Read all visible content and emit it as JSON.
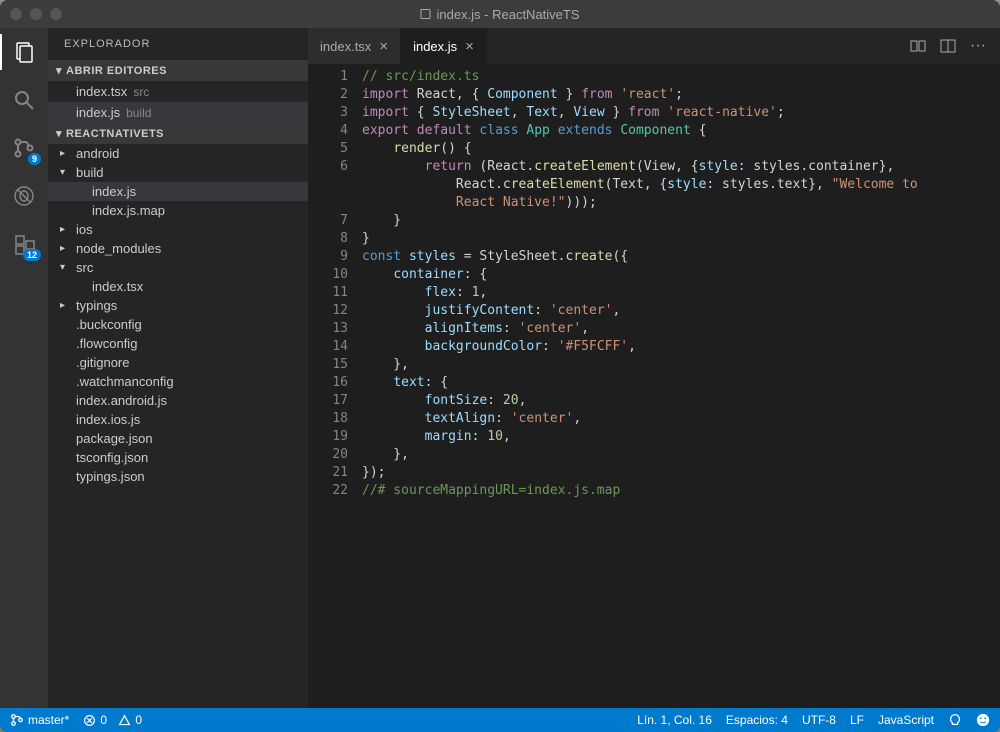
{
  "window": {
    "title": "index.js - ReactNativeTS"
  },
  "activitybar": {
    "badges": {
      "scm": "9",
      "extensions": "12"
    }
  },
  "sidebar": {
    "title": "EXPLORADOR",
    "openEditorsHeader": "ABRIR EDITORES",
    "openEditors": [
      {
        "name": "index.tsx",
        "hint": "src"
      },
      {
        "name": "index.js",
        "hint": "build"
      }
    ],
    "projectHeader": "REACTNATIVETS",
    "tree": [
      {
        "label": "android",
        "depth": 0,
        "arrow": "▸"
      },
      {
        "label": "build",
        "depth": 0,
        "arrow": "▾"
      },
      {
        "label": "index.js",
        "depth": 1,
        "arrow": "",
        "selected": true
      },
      {
        "label": "index.js.map",
        "depth": 1,
        "arrow": ""
      },
      {
        "label": "ios",
        "depth": 0,
        "arrow": "▸"
      },
      {
        "label": "node_modules",
        "depth": 0,
        "arrow": "▸"
      },
      {
        "label": "src",
        "depth": 0,
        "arrow": "▾"
      },
      {
        "label": "index.tsx",
        "depth": 1,
        "arrow": ""
      },
      {
        "label": "typings",
        "depth": 0,
        "arrow": "▸"
      },
      {
        "label": ".buckconfig",
        "depth": 0,
        "arrow": ""
      },
      {
        "label": ".flowconfig",
        "depth": 0,
        "arrow": ""
      },
      {
        "label": ".gitignore",
        "depth": 0,
        "arrow": ""
      },
      {
        "label": ".watchmanconfig",
        "depth": 0,
        "arrow": ""
      },
      {
        "label": "index.android.js",
        "depth": 0,
        "arrow": ""
      },
      {
        "label": "index.ios.js",
        "depth": 0,
        "arrow": ""
      },
      {
        "label": "package.json",
        "depth": 0,
        "arrow": ""
      },
      {
        "label": "tsconfig.json",
        "depth": 0,
        "arrow": ""
      },
      {
        "label": "typings.json",
        "depth": 0,
        "arrow": ""
      }
    ]
  },
  "tabs": [
    {
      "label": "index.tsx",
      "active": false
    },
    {
      "label": "index.js",
      "active": true
    }
  ],
  "code": {
    "lines": [
      [
        {
          "c": "tk-c",
          "t": "// src/index.ts"
        }
      ],
      [
        {
          "c": "tk-k",
          "t": "import"
        },
        {
          "t": " React, { "
        },
        {
          "c": "tk-v",
          "t": "Component"
        },
        {
          "t": " } "
        },
        {
          "c": "tk-k",
          "t": "from"
        },
        {
          "t": " "
        },
        {
          "c": "tk-s",
          "t": "'react'"
        },
        {
          "t": ";"
        }
      ],
      [
        {
          "c": "tk-k",
          "t": "import"
        },
        {
          "t": " { "
        },
        {
          "c": "tk-v",
          "t": "StyleSheet"
        },
        {
          "t": ", "
        },
        {
          "c": "tk-v",
          "t": "Text"
        },
        {
          "t": ", "
        },
        {
          "c": "tk-v",
          "t": "View"
        },
        {
          "t": " } "
        },
        {
          "c": "tk-k",
          "t": "from"
        },
        {
          "t": " "
        },
        {
          "c": "tk-s",
          "t": "'react-native'"
        },
        {
          "t": ";"
        }
      ],
      [
        {
          "c": "tk-k",
          "t": "export"
        },
        {
          "t": " "
        },
        {
          "c": "tk-k",
          "t": "default"
        },
        {
          "t": " "
        },
        {
          "c": "tk-b",
          "t": "class"
        },
        {
          "t": " "
        },
        {
          "c": "tk-t",
          "t": "App"
        },
        {
          "t": " "
        },
        {
          "c": "tk-b",
          "t": "extends"
        },
        {
          "t": " "
        },
        {
          "c": "tk-t",
          "t": "Component"
        },
        {
          "t": " {"
        }
      ],
      [
        {
          "t": "    "
        },
        {
          "c": "tk-f",
          "t": "render"
        },
        {
          "t": "() {"
        }
      ],
      [
        {
          "t": "        "
        },
        {
          "c": "tk-k",
          "t": "return"
        },
        {
          "t": " (React."
        },
        {
          "c": "tk-f",
          "t": "createElement"
        },
        {
          "t": "(View, {"
        },
        {
          "c": "tk-v",
          "t": "style"
        },
        {
          "t": ": styles.container},"
        }
      ],
      [
        {
          "t": "            React."
        },
        {
          "c": "tk-f",
          "t": "createElement"
        },
        {
          "t": "(Text, {"
        },
        {
          "c": "tk-v",
          "t": "style"
        },
        {
          "t": ": styles.text}, "
        },
        {
          "c": "tk-s",
          "t": "\"Welcome to"
        }
      ],
      [
        {
          "c": "tk-s",
          "t": "            React Native!\""
        },
        {
          "t": ")));"
        }
      ],
      [
        {
          "t": "    }"
        }
      ],
      [
        {
          "t": "}"
        }
      ],
      [
        {
          "c": "tk-b",
          "t": "const"
        },
        {
          "t": " "
        },
        {
          "c": "tk-v",
          "t": "styles"
        },
        {
          "t": " = StyleSheet."
        },
        {
          "c": "tk-f",
          "t": "create"
        },
        {
          "t": "({"
        }
      ],
      [
        {
          "t": "    "
        },
        {
          "c": "tk-v",
          "t": "container"
        },
        {
          "t": ": {"
        }
      ],
      [
        {
          "t": "        "
        },
        {
          "c": "tk-v",
          "t": "flex"
        },
        {
          "t": ": "
        },
        {
          "c": "tk-n",
          "t": "1"
        },
        {
          "t": ","
        }
      ],
      [
        {
          "t": "        "
        },
        {
          "c": "tk-v",
          "t": "justifyContent"
        },
        {
          "t": ": "
        },
        {
          "c": "tk-s",
          "t": "'center'"
        },
        {
          "t": ","
        }
      ],
      [
        {
          "t": "        "
        },
        {
          "c": "tk-v",
          "t": "alignItems"
        },
        {
          "t": ": "
        },
        {
          "c": "tk-s",
          "t": "'center'"
        },
        {
          "t": ","
        }
      ],
      [
        {
          "t": "        "
        },
        {
          "c": "tk-v",
          "t": "backgroundColor"
        },
        {
          "t": ": "
        },
        {
          "c": "tk-s",
          "t": "'#F5FCFF'"
        },
        {
          "t": ","
        }
      ],
      [
        {
          "t": "    },"
        }
      ],
      [
        {
          "t": "    "
        },
        {
          "c": "tk-v",
          "t": "text"
        },
        {
          "t": ": {"
        }
      ],
      [
        {
          "t": "        "
        },
        {
          "c": "tk-v",
          "t": "fontSize"
        },
        {
          "t": ": "
        },
        {
          "c": "tk-n",
          "t": "20"
        },
        {
          "t": ","
        }
      ],
      [
        {
          "t": "        "
        },
        {
          "c": "tk-v",
          "t": "textAlign"
        },
        {
          "t": ": "
        },
        {
          "c": "tk-s",
          "t": "'center'"
        },
        {
          "t": ","
        }
      ],
      [
        {
          "t": "        "
        },
        {
          "c": "tk-v",
          "t": "margin"
        },
        {
          "t": ": "
        },
        {
          "c": "tk-n",
          "t": "10"
        },
        {
          "t": ","
        }
      ],
      [
        {
          "t": "    },"
        }
      ],
      [
        {
          "t": "});"
        }
      ],
      [
        {
          "c": "tk-c",
          "t": "//# sourceMappingURL=index.js.map"
        }
      ]
    ],
    "displayLineNumbers": [
      1,
      2,
      3,
      4,
      5,
      6,
      null,
      null,
      7,
      8,
      9,
      10,
      11,
      12,
      13,
      14,
      15,
      16,
      17,
      18,
      19,
      20,
      21,
      22
    ]
  },
  "statusbar": {
    "branch": "master*",
    "errors": "0",
    "warnings": "0",
    "position": "Lín. 1, Col. 16",
    "spaces": "Espacios: 4",
    "encoding": "UTF-8",
    "eol": "LF",
    "language": "JavaScript"
  }
}
